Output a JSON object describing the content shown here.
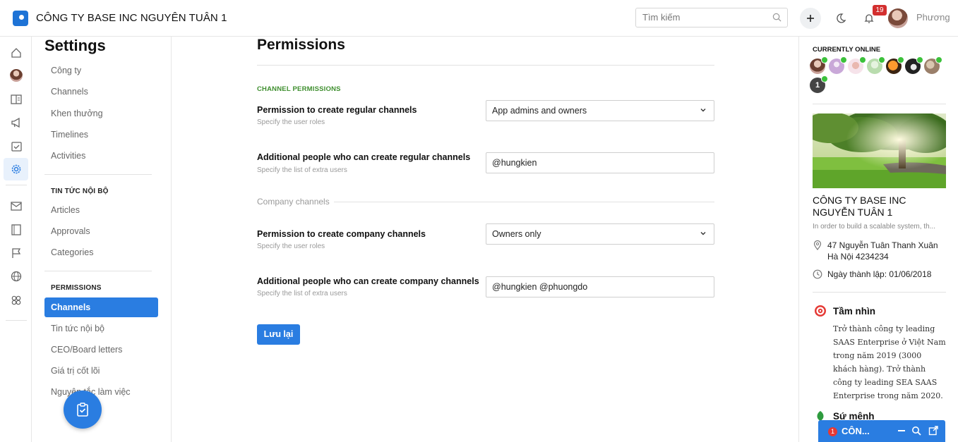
{
  "header": {
    "company": "CÔNG TY BASE INC NGUYÊN TUÂN 1",
    "search_placeholder": "Tìm kiếm",
    "notification_count": "19",
    "user_name": "Phương"
  },
  "settings": {
    "title": "Settings",
    "items": [
      "Công ty",
      "Channels",
      "Khen thưởng",
      "Timelines",
      "Activities"
    ],
    "section_news": "TIN TỨC NỘI BỘ",
    "news_items": [
      "Articles",
      "Approvals",
      "Categories"
    ],
    "section_permissions": "PERMISSIONS",
    "permission_items": [
      "Channels",
      "Tin tức nội bộ",
      "CEO/Board letters",
      "Giá trị cốt lõi",
      "Nguyên tắc làm việc"
    ]
  },
  "main": {
    "title": "Permissions",
    "section": "CHANNEL PERMISSIONS",
    "fields": [
      {
        "label": "Permission to create regular channels",
        "sub": "Specify the user roles",
        "value": "App admins and owners"
      },
      {
        "label": "Additional people who can create regular channels",
        "sub": "Specify the list of extra users",
        "value": "@hungkien"
      },
      {
        "label": "Permission to create company channels",
        "sub": "Specify the user roles",
        "value": "Owners only"
      },
      {
        "label": "Additional people who can create company channels",
        "sub": "Specify the list of extra users",
        "value": "@hungkien @phuongdo"
      }
    ],
    "group": "Company channels",
    "save": "Lưu lại"
  },
  "right": {
    "online_title": "CURRENTLY ONLINE",
    "online_more": "1",
    "company": "CÔNG TY BASE INC NGUYỄN TUÂN 1",
    "desc": "In order to build a scalable system, th...",
    "address": "47 Nguyễn Tuân Thanh Xuân Hà Nội 4234234",
    "founded": "Ngày thành lập: 01/06/2018",
    "vision_title": "Tầm nhìn",
    "vision_body": "Trở thành công ty leading SAAS Enterprise ở Việt Nam trong năm 2019 (3000 khách hàng). Trở thành công ty leading SEA SAAS Enterprise trong năm 2020.",
    "mission_title": "Sứ mệnh"
  },
  "chat": {
    "badge": "1",
    "title": "CÔN..."
  },
  "colors": {
    "accent": "#2a7de1",
    "online": "#3cc13b",
    "badge": "#d32f2f",
    "section": "#3f8f2f"
  }
}
